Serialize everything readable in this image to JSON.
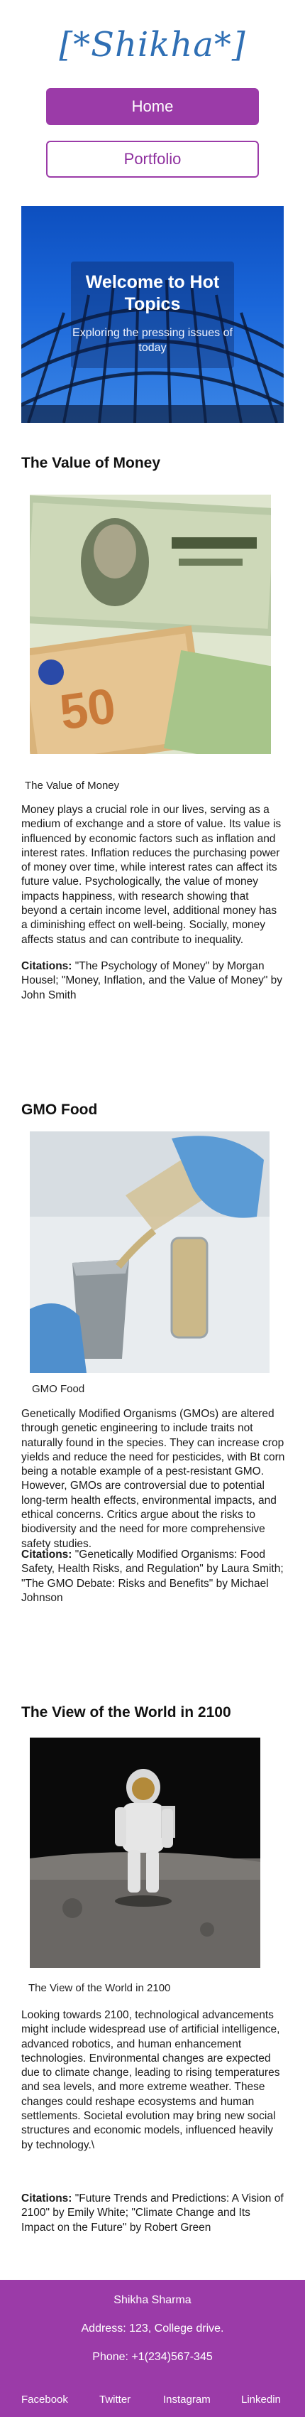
{
  "header": {
    "logo_text": "[*Shikha*]"
  },
  "nav": {
    "home": "Home",
    "portfolio": "Portfolio"
  },
  "hero": {
    "title": "Welcome to Hot Topics",
    "subtitle": "Exploring the pressing issues of today"
  },
  "articles": [
    {
      "title": "The Value of Money",
      "caption": "The Value of Money",
      "body": "Money plays a crucial role in our lives, serving as a medium of exchange and a store of value. Its value is influenced by economic factors such as inflation and interest rates. Inflation reduces the purchasing power of money over time, while interest rates can affect its future value. Psychologically, the value of money impacts happiness, with research showing that beyond a certain income level, additional money has a diminishing effect on well-being. Socially, money affects status and can contribute to inequality.",
      "citations_label": "Citations:",
      "citations": "\"The Psychology of Money\" by Morgan Housel; \"Money, Inflation, and the Value of Money\" by John Smith"
    },
    {
      "title": "GMO Food",
      "caption": "GMO Food",
      "body": "Genetically Modified Organisms (GMOs) are altered through genetic engineering to include traits not naturally found in the species. They can increase crop yields and reduce the need for pesticides, with Bt corn being a notable example of a pest-resistant GMO. However, GMOs are controversial due to potential long-term health effects, environmental impacts, and ethical concerns. Critics argue about the risks to biodiversity and the need for more comprehensive safety studies.",
      "citations_label": "Citations:",
      "citations": "\"Genetically Modified Organisms: Food Safety, Health Risks, and Regulation\" by Laura Smith; \"The GMO Debate: Risks and Benefits\" by Michael Johnson"
    },
    {
      "title": "The View of the World in 2100",
      "caption": "The View of the World in 2100",
      "body": "Looking towards 2100, technological advancements might include widespread use of artificial intelligence, advanced robotics, and human enhancement technologies. Environmental changes are expected due to climate change, leading to rising temperatures and sea levels, and more extreme weather. These changes could reshape ecosystems and human settlements. Societal evolution may bring new social structures and economic models, influenced heavily by technology.\\",
      "citations_label": "Citations:",
      "citations": "\"Future Trends and Predictions: A Vision of 2100\" by Emily White; \"Climate Change and Its Impact on the Future\" by Robert Green"
    }
  ],
  "footer": {
    "name": "Shikha Sharma",
    "address": "Address: 123, College drive.",
    "phone": "Phone: +1(234)567-345",
    "links": [
      "Facebook",
      "Twitter",
      "Instagram",
      "Linkedin"
    ]
  },
  "colors": {
    "accent": "#9b3ba8",
    "logo": "#2f6fb4"
  }
}
